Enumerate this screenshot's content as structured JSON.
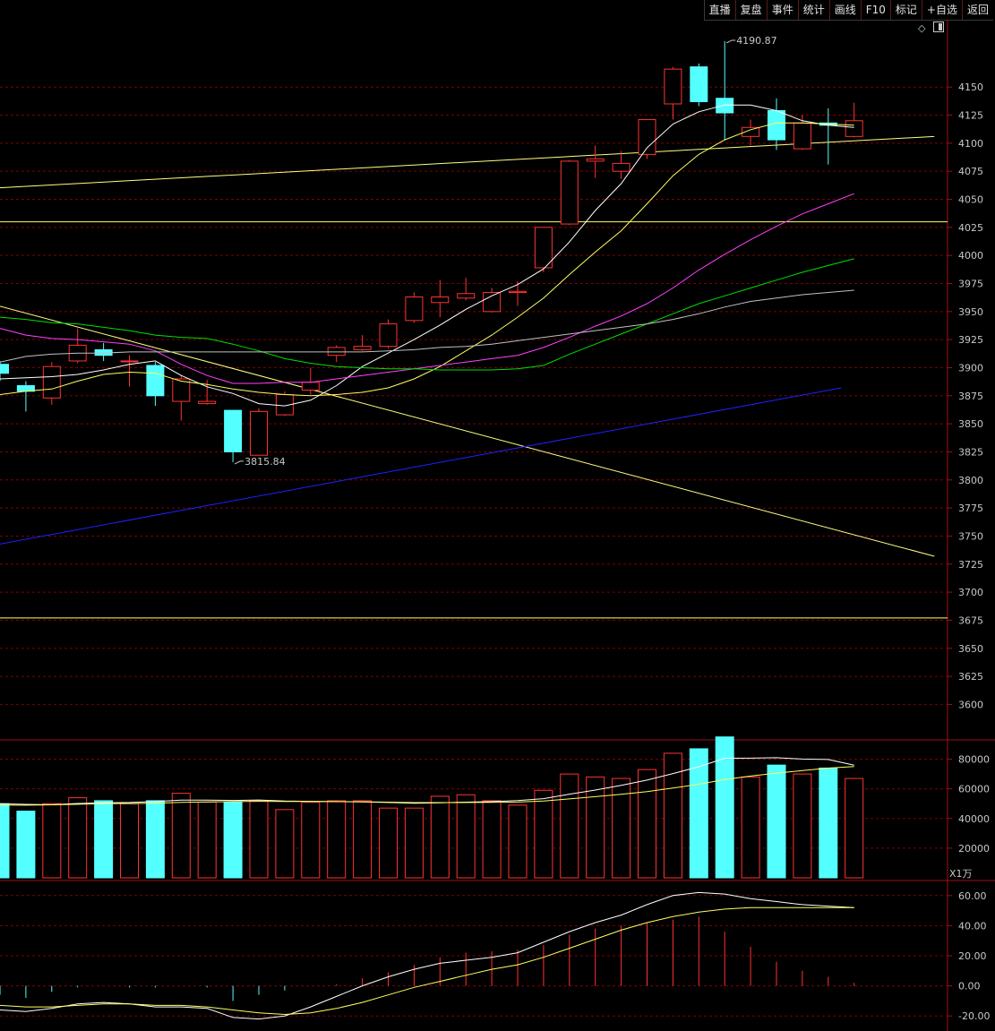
{
  "toolbar": {
    "items": [
      "直播",
      "复盘",
      "事件",
      "统计",
      "画线",
      "F10",
      "标记",
      "+自选",
      "返回"
    ]
  },
  "icons": [
    "diamond-icon",
    "window-toggle-icon"
  ],
  "colors": {
    "background": "#000000",
    "up": "#ff3232",
    "down": "#54ffff",
    "grid": "#800000",
    "axis_text": "#c8c8c8",
    "ma_white": "#ffffff",
    "ma_yellow": "#ffff60",
    "ma_magenta": "#ff40ff",
    "ma_green": "#00e000",
    "ma_gray": "#c0c0c0",
    "trend_yellow": "#ffff80",
    "trend_blue": "#2020ff",
    "hline_yellow": "#ffff60"
  },
  "chart_data": [
    {
      "type": "candlestick",
      "title": "",
      "ylim": [
        3570,
        4210
      ],
      "y_ticks": [
        4150,
        4125,
        4100,
        4075,
        4050,
        4025,
        4000,
        3975,
        3950,
        3925,
        3900,
        3875,
        3850,
        3825,
        3800,
        3775,
        3750,
        3725,
        3700,
        3675,
        3650,
        3625,
        3600
      ],
      "y_tick_labels": [
        "4150",
        "4125",
        "4100",
        "4075",
        "4050",
        "4025",
        "4000",
        "3975",
        "3950",
        "3925",
        "3900",
        "3875",
        "3850",
        "3825",
        "3800",
        "3775",
        "3750",
        "3725",
        "3700",
        "3675",
        "3650",
        "3625",
        "3600"
      ],
      "candles": [
        {
          "o": 3903,
          "c": 3895,
          "h": 3906,
          "l": 3888
        },
        {
          "o": 3884,
          "c": 3879,
          "h": 3888,
          "l": 3861
        },
        {
          "o": 3873,
          "c": 3901,
          "h": 3905,
          "l": 3867
        },
        {
          "o": 3906,
          "c": 3920,
          "h": 3935,
          "l": 3904
        },
        {
          "o": 3916,
          "c": 3911,
          "h": 3922,
          "l": 3906
        },
        {
          "o": 3906,
          "c": 3906,
          "h": 3911,
          "l": 3883
        },
        {
          "o": 3902,
          "c": 3875,
          "h": 3905,
          "l": 3866
        },
        {
          "o": 3870,
          "c": 3890,
          "h": 3893,
          "l": 3853
        },
        {
          "o": 3868,
          "c": 3870,
          "h": 3889,
          "l": 3867
        },
        {
          "o": 3862,
          "c": 3825,
          "h": 3862,
          "l": 3815.84
        },
        {
          "o": 3822,
          "c": 3861,
          "h": 3864,
          "l": 3822
        },
        {
          "o": 3858,
          "c": 3876,
          "h": 3879,
          "l": 3857
        },
        {
          "o": 3880,
          "c": 3887,
          "h": 3900,
          "l": 3876
        },
        {
          "o": 3911,
          "c": 3918,
          "h": 3920,
          "l": 3905
        },
        {
          "o": 3916,
          "c": 3919,
          "h": 3929,
          "l": 3915
        },
        {
          "o": 3919,
          "c": 3939,
          "h": 3943,
          "l": 3917
        },
        {
          "o": 3942,
          "c": 3963,
          "h": 3967,
          "l": 3940
        },
        {
          "o": 3958,
          "c": 3963,
          "h": 3978,
          "l": 3945
        },
        {
          "o": 3962,
          "c": 3966,
          "h": 3980,
          "l": 3960
        },
        {
          "o": 3950,
          "c": 3967,
          "h": 3971,
          "l": 3949
        },
        {
          "o": 3967,
          "c": 3968,
          "h": 3977,
          "l": 3955
        },
        {
          "o": 3989,
          "c": 4025,
          "h": 4025,
          "l": 3985
        },
        {
          "o": 4028,
          "c": 4084,
          "h": 4085,
          "l": 4027
        },
        {
          "o": 4084,
          "c": 4086,
          "h": 4098,
          "l": 4069
        },
        {
          "o": 4075,
          "c": 4082,
          "h": 4093,
          "l": 4068
        },
        {
          "o": 4090,
          "c": 4121,
          "h": 4121,
          "l": 4086
        },
        {
          "o": 4135,
          "c": 4166,
          "h": 4168,
          "l": 4121
        },
        {
          "o": 4168,
          "c": 4137,
          "h": 4171,
          "l": 4133
        },
        {
          "o": 4140,
          "c": 4127,
          "h": 4190.87,
          "l": 4103
        },
        {
          "o": 4106,
          "c": 4114,
          "h": 4121,
          "l": 4098
        },
        {
          "o": 4129,
          "c": 4103,
          "h": 4140,
          "l": 4094
        },
        {
          "o": 4095,
          "c": 4118,
          "h": 4125,
          "l": 4094
        },
        {
          "o": 4118,
          "c": 4116,
          "h": 4131,
          "l": 4081
        },
        {
          "o": 4106,
          "c": 4120,
          "h": 4136,
          "l": 4105
        }
      ],
      "moving_averages": [
        {
          "color": "white",
          "values": [
            3890,
            3891,
            3892,
            3894,
            3898,
            3903,
            3906,
            3893,
            3883,
            3877,
            3868,
            3866,
            3871,
            3884,
            3901,
            3913,
            3925,
            3938,
            3952,
            3964,
            3974,
            3988,
            4012,
            4040,
            4064,
            4096,
            4117,
            4128,
            4134,
            4134,
            4129,
            4120,
            4116,
            4114
          ]
        },
        {
          "color": "yellow",
          "values": [
            3876,
            3879,
            3881,
            3888,
            3894,
            3896,
            3895,
            3888,
            3885,
            3881,
            3878,
            3876,
            3875,
            3876,
            3878,
            3882,
            3890,
            3901,
            3915,
            3929,
            3945,
            3962,
            3983,
            4003,
            4022,
            4046,
            4071,
            4090,
            4103,
            4112,
            4118,
            4118,
            4117,
            4116
          ]
        },
        {
          "color": "magenta",
          "values": [
            3935,
            3929,
            3926,
            3925,
            3923,
            3921,
            3915,
            3903,
            3893,
            3886,
            3886,
            3887,
            3887,
            3890,
            3893,
            3896,
            3899,
            3902,
            3905,
            3908,
            3911,
            3918,
            3927,
            3937,
            3946,
            3957,
            3971,
            3987,
            4001,
            4014,
            4026,
            4037,
            4046,
            4055
          ]
        },
        {
          "color": "green",
          "values": [
            3945,
            3943,
            3940,
            3939,
            3936,
            3933,
            3929,
            3927,
            3926,
            3921,
            3915,
            3908,
            3904,
            3901,
            3900,
            3899,
            3899,
            3898,
            3898,
            3898,
            3899,
            3902,
            3912,
            3921,
            3930,
            3939,
            3948,
            3957,
            3964,
            3971,
            3978,
            3985,
            3991,
            3997
          ]
        },
        {
          "color": "gray",
          "values": [
            3905,
            3910,
            3912,
            3913,
            3913,
            3914,
            3914,
            3914,
            3914,
            3914,
            3914,
            3914,
            3914,
            3914,
            3914,
            3915,
            3916,
            3918,
            3919,
            3921,
            3924,
            3927,
            3930,
            3933,
            3936,
            3939,
            3943,
            3948,
            3954,
            3959,
            3962,
            3965,
            3967,
            3969
          ]
        }
      ],
      "trend_lines": [
        {
          "color": "trend_yellow",
          "from": [
            -0.2,
            4060
          ],
          "to": [
            36.1,
            4106
          ]
        },
        {
          "color": "trend_yellow",
          "from": [
            -0.2,
            3956
          ],
          "to": [
            36.1,
            3732
          ]
        },
        {
          "color": "trend_blue",
          "from": [
            -0.2,
            3742
          ],
          "to": [
            32.5,
            3882
          ]
        }
      ],
      "horizontal_lines": [
        {
          "color": "hline_yellow",
          "y": 4030
        },
        {
          "color": "hline_yellow",
          "y": 3677
        }
      ],
      "annotations": [
        {
          "text": "4190.87",
          "index": 28,
          "y": 4190.87,
          "side": "right"
        },
        {
          "text": "3815.84",
          "index": 9,
          "y": 3815.84,
          "side": "right"
        }
      ]
    },
    {
      "type": "bar",
      "title": "",
      "unit_label": "X1万",
      "ylim": [
        0,
        93000
      ],
      "y_ticks": [
        80000,
        60000,
        40000,
        20000
      ],
      "y_tick_labels": [
        "80000",
        "60000",
        "40000",
        "20000"
      ],
      "volumes": [
        50000,
        45000,
        50000,
        54000,
        52000,
        50000,
        52000,
        57000,
        51000,
        51000,
        52000,
        46000,
        51000,
        52000,
        52000,
        47000,
        47000,
        55000,
        56000,
        52000,
        49000,
        59000,
        70000,
        68000,
        67000,
        73000,
        84000,
        87000,
        95000,
        68000,
        76000,
        70000,
        74000,
        67000
      ],
      "ma_lines": [
        {
          "color": "white",
          "values": [
            50000,
            49500,
            49300,
            50100,
            50600,
            50800,
            51400,
            52400,
            52400,
            52200,
            52500,
            51800,
            51600,
            51400,
            51200,
            50800,
            50300,
            50600,
            51000,
            51400,
            52100,
            53400,
            56400,
            59200,
            62300,
            65900,
            70300,
            74900,
            80600,
            80700,
            81000,
            80100,
            79800,
            76000
          ]
        },
        {
          "color": "yellow",
          "values": [
            49000,
            49000,
            49200,
            49600,
            50000,
            50100,
            50300,
            50900,
            51200,
            51400,
            51600,
            51500,
            51500,
            51400,
            51300,
            51000,
            50700,
            50700,
            50800,
            50900,
            51100,
            51800,
            53200,
            54700,
            56300,
            58100,
            60500,
            63100,
            66300,
            68600,
            70600,
            72300,
            74000,
            75000
          ]
        }
      ]
    },
    {
      "type": "bar",
      "title": "",
      "ylim": [
        -30,
        70
      ],
      "y_ticks": [
        60,
        40,
        20,
        0,
        -20
      ],
      "y_tick_labels": [
        "60.00",
        "40.00",
        "20.00",
        "0.00",
        "-20.00"
      ],
      "histogram": [
        -6,
        -8,
        -4,
        -1,
        0,
        -1,
        -1,
        0,
        -1,
        -10,
        -6,
        -3,
        0,
        1,
        5,
        9,
        14,
        19,
        22,
        23,
        24,
        27,
        34,
        38,
        40,
        42,
        44,
        46,
        36,
        26,
        16,
        10,
        6,
        2
      ],
      "diff_line": {
        "color": "white",
        "values": [
          -16,
          -17,
          -15,
          -12,
          -11,
          -12,
          -14,
          -14,
          -15,
          -21,
          -22,
          -20,
          -14,
          -7,
          0,
          6,
          11,
          15,
          17,
          19,
          22,
          29,
          36,
          42,
          47,
          54,
          60,
          62,
          61,
          58,
          56,
          54,
          53,
          52
        ]
      },
      "dea_line": {
        "color": "yellow",
        "values": [
          -13,
          -14,
          -14,
          -13,
          -12,
          -12,
          -13,
          -13,
          -14,
          -16,
          -18,
          -19,
          -18,
          -15,
          -11,
          -6,
          -1,
          3,
          7,
          11,
          14,
          19,
          25,
          31,
          37,
          42,
          46,
          49,
          51,
          52,
          52,
          52,
          52,
          52
        ]
      }
    }
  ]
}
